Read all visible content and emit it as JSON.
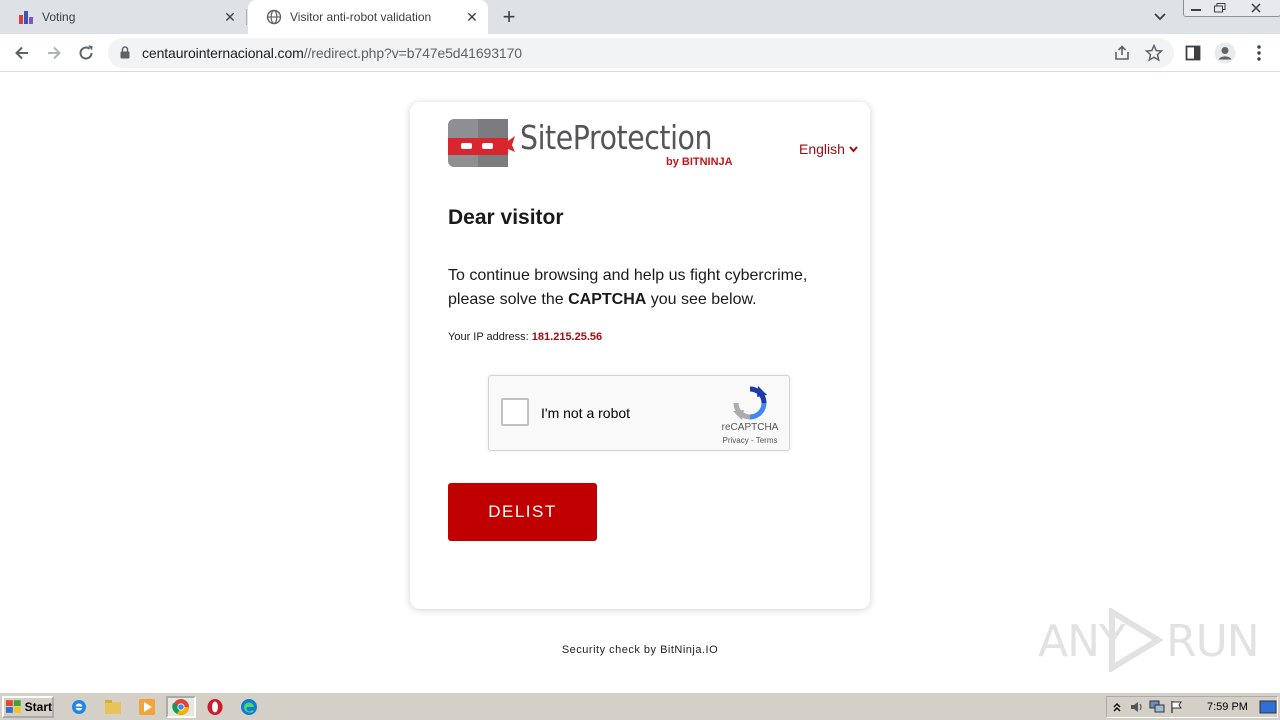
{
  "browser": {
    "tabs": [
      {
        "title": "Voting",
        "favicon": "chart-logo-icon",
        "active": false
      },
      {
        "title": "Visitor anti-robot validation",
        "favicon": "globe-icon",
        "active": true
      }
    ],
    "url": {
      "domain": "centaurointernacional.com",
      "path": "//redirect.php?v=b747e5d41693170"
    }
  },
  "page": {
    "logo_text": "SiteProtection",
    "logo_by": "by BITNINJA",
    "language": "English",
    "heading": "Dear visitor",
    "paragraph_part1": "To continue browsing and help us fight cybercrime, please solve the",
    "paragraph_bold": "CAPTCHA",
    "paragraph_part2": "you see below.",
    "ip_label": "Your IP address:",
    "ip_value": "181.215.25.56",
    "recaptcha": {
      "label": "I'm not a robot",
      "brand": "reCAPTCHA",
      "privacy": "Privacy",
      "separator": " - ",
      "terms": "Terms"
    },
    "delist_button": "DELIST",
    "footer": "Security check by BitNinja.IO",
    "colors": {
      "brand_red": "#c00000",
      "link_red": "#a00d14"
    }
  },
  "watermark": {
    "text_left": "ANY",
    "text_right": "RUN"
  },
  "taskbar": {
    "start_label": "Start",
    "apps": [
      "internet-explorer-icon",
      "folder-icon",
      "media-player-icon",
      "chrome-icon",
      "opera-icon",
      "edge-icon"
    ],
    "clock": "7:59 PM"
  }
}
